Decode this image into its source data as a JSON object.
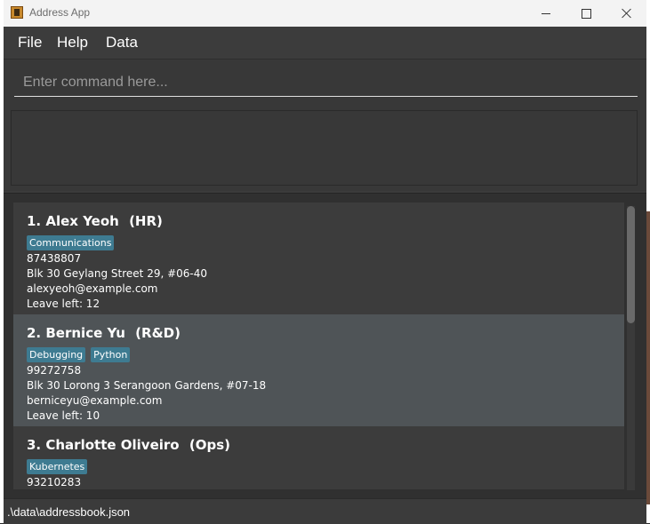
{
  "window": {
    "title": "Address App"
  },
  "menu": {
    "file": "File",
    "help": "Help",
    "data": "Data"
  },
  "command": {
    "placeholder": "Enter command here...",
    "value": ""
  },
  "result": {
    "text": ""
  },
  "persons": [
    {
      "index": "1.",
      "name": "Alex Yeoh",
      "department": "(HR)",
      "tags": [
        "Communications"
      ],
      "phone": "87438807",
      "address": "Blk 30 Geylang Street 29, #06-40",
      "email": "alexyeoh@example.com",
      "leave": "Leave left: 12"
    },
    {
      "index": "2.",
      "name": "Bernice Yu",
      "department": "(R&D)",
      "tags": [
        "Debugging",
        "Python"
      ],
      "phone": "99272758",
      "address": "Blk 30 Lorong 3 Serangoon Gardens, #07-18",
      "email": "berniceyu@example.com",
      "leave": "Leave left: 10"
    },
    {
      "index": "3.",
      "name": "Charlotte Oliveiro",
      "department": "(Ops)",
      "tags": [
        "Kubernetes"
      ],
      "phone": "93210283",
      "address": "",
      "email": "",
      "leave": ""
    }
  ],
  "status": {
    "path": ".\\data\\addressbook.json"
  },
  "colors": {
    "tag": "#3e7b91",
    "card_alt": "#4f5457",
    "card": "#3c3c3c"
  }
}
